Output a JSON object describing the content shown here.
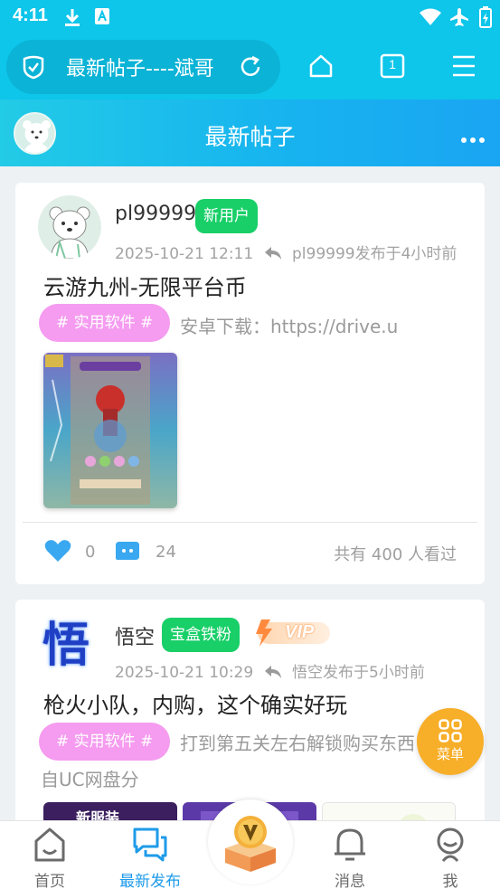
{
  "status_bar": {
    "time": "4:11"
  },
  "browser": {
    "url_title": "最新帖子----斌哥",
    "tab_count": "1"
  },
  "page_header": {
    "title": "最新帖子"
  },
  "posts": [
    {
      "username": "pl99999",
      "badge": "新用户",
      "timestamp": "2025-10-21 12:11",
      "reply_info": "pl99999发布于4小时前",
      "title": "云游九州-无限平台币",
      "tag": "# 实用软件 #",
      "excerpt": "安卓下载：https://drive.u",
      "likes": "0",
      "comments": "24",
      "views": "共有 400 人看过"
    },
    {
      "username": "悟空",
      "badge": "宝盒铁粉",
      "vip_label": "VIP",
      "avatar_char": "悟",
      "timestamp": "2025-10-21 10:29",
      "reply_info": "悟空发布于5小时前",
      "title": "枪火小队，内购，这个确实好玩",
      "tag": "# 实用软件 #",
      "excerpt": "打到第五关左右解锁购买东西",
      "excerpt_cont": "自UC网盘分",
      "thumb1_text": "新服装"
    }
  ],
  "fab": {
    "label": "菜单"
  },
  "bottom_nav": {
    "items": [
      {
        "label": "首页"
      },
      {
        "label": "最新发布"
      },
      {
        "label": "消息"
      },
      {
        "label": "我"
      }
    ]
  },
  "colors": {
    "accent": "#0ec5ea",
    "badge_green": "#18cf68",
    "tag_pink": "#f59bf0",
    "like_blue": "#3aa8f0",
    "fab_orange": "#f7ae28",
    "nav_active": "#1e9be9"
  }
}
